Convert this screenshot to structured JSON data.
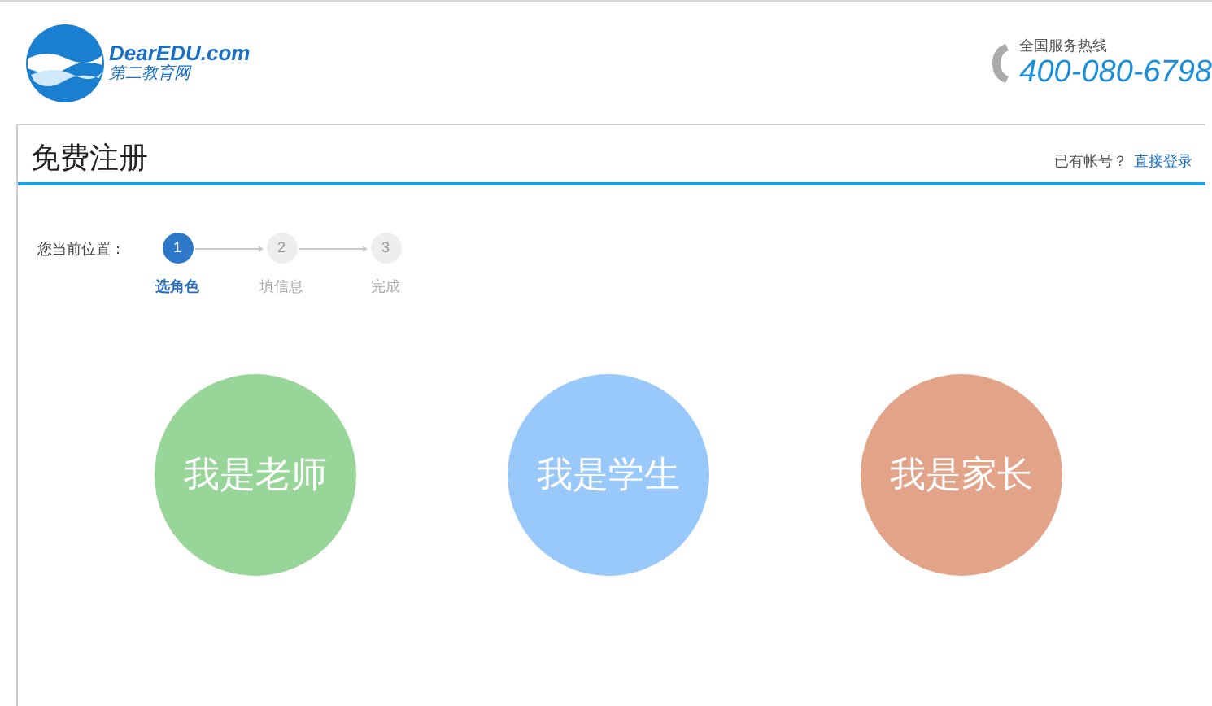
{
  "header": {
    "logo_text": "DearEDU.com",
    "logo_subtext": "第二教育网",
    "hotline_label": "全国服务热线",
    "hotline_number": "400-080-6798"
  },
  "page": {
    "title": "免费注册",
    "login_prompt": "已有帐号？",
    "login_link": "直接登录"
  },
  "steps": {
    "label": "您当前位置：",
    "items": [
      {
        "number": "1",
        "label": "选角色",
        "selected": true
      },
      {
        "number": "2",
        "label": "填信息",
        "selected": false
      },
      {
        "number": "3",
        "label": "完成",
        "selected": false
      }
    ]
  },
  "roles": [
    {
      "label": "我是老师",
      "color": "#98d598"
    },
    {
      "label": "我是学生",
      "color": "#99c8fb"
    },
    {
      "label": "我是家长",
      "color": "#e3a389"
    }
  ]
}
